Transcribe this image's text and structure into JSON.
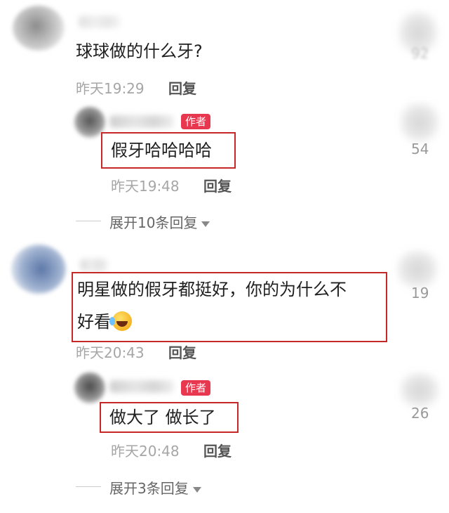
{
  "comments": [
    {
      "text": "球球做的什么牙?",
      "time": "昨天19:29",
      "reply_label": "回复",
      "likes": "92",
      "reply": {
        "author_tag": "作者",
        "text": "假牙哈哈哈哈",
        "time": "昨天19:48",
        "reply_label": "回复",
        "likes": "54"
      },
      "expand_label": "展开10条回复"
    },
    {
      "text_line1": "明星做的假牙都挺好，你的为什么不",
      "text_line2": "好看",
      "emoji": "laughing-crying-emoji",
      "time": "昨天20:43",
      "reply_label": "回复",
      "likes": "19",
      "reply": {
        "author_tag": "作者",
        "text": "做大了 做长了",
        "time": "昨天20:48",
        "reply_label": "回复",
        "likes": "26"
      },
      "expand_label": "展开3条回复"
    }
  ],
  "colors": {
    "author_tag": "#e8384f",
    "highlight": "#c62828",
    "meta": "#a6a6a6"
  }
}
